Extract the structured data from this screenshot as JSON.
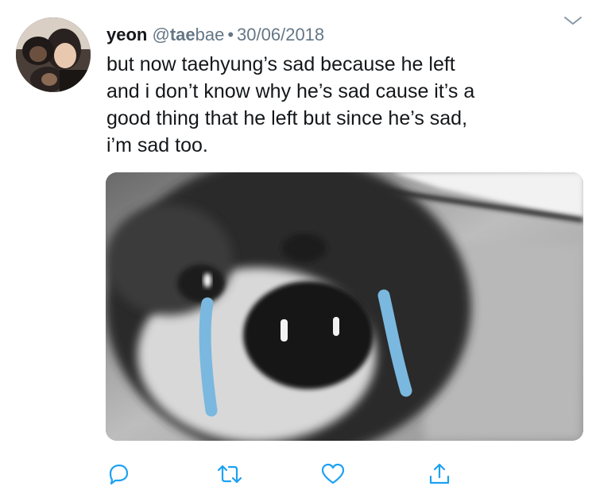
{
  "tweet": {
    "name": "yeon",
    "handle_prefix": "@",
    "handle_bold": "tae",
    "handle_rest": "bae",
    "separator": "•",
    "date": "30/06/2018",
    "text_lines": [
      "but now taehyung’s sad because he left",
      "and i don’t know why he’s sad cause it’s a",
      "good thing that he left but since he’s sad,",
      "i’m sad too."
    ]
  },
  "icons": {
    "menu": "chevron-down-icon",
    "reply": "reply-icon",
    "retweet": "retweet-icon",
    "like": "heart-icon",
    "share": "share-icon"
  },
  "colors": {
    "text": "#14171a",
    "secondary": "#657786",
    "tear": "#7ab8e0"
  }
}
